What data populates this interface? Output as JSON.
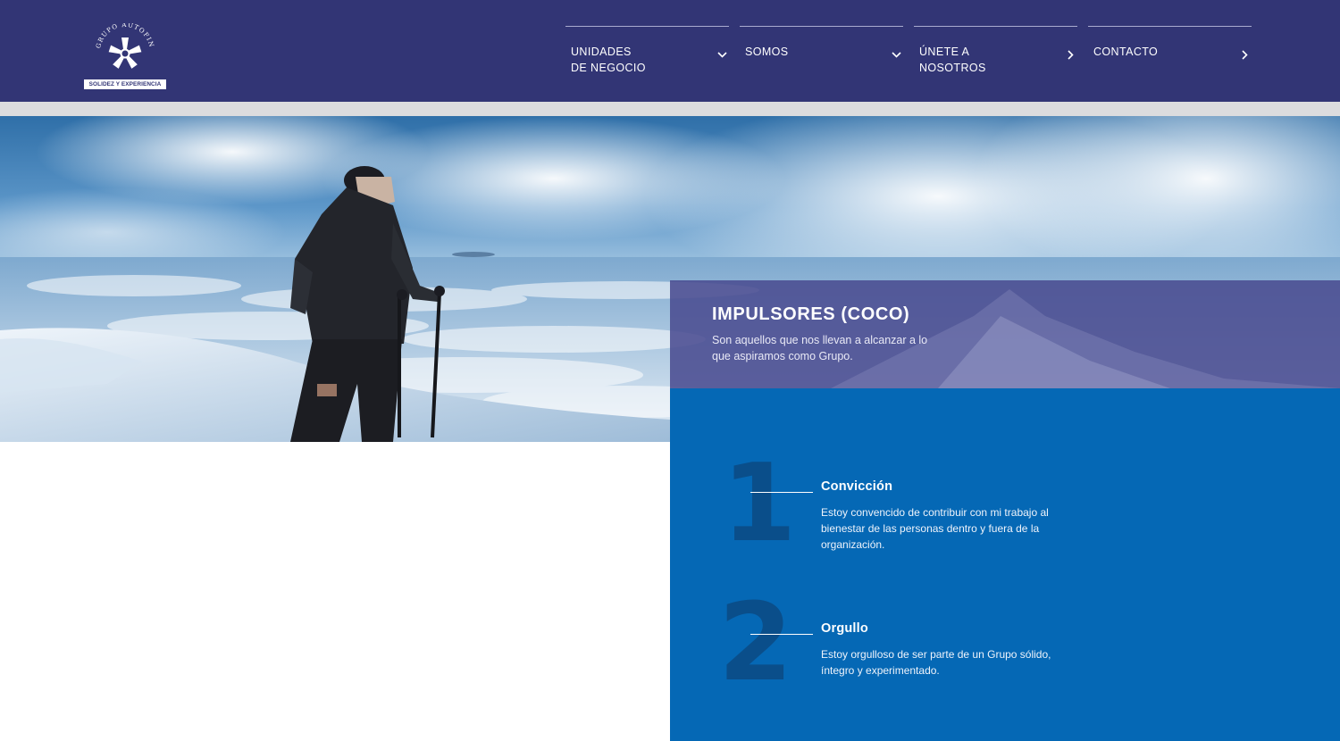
{
  "logo": {
    "arc_text": "GRUPO AUTOFIN MÉXICO",
    "tagline": "SOLIDEZ Y EXPERIENCIA"
  },
  "nav": [
    {
      "label": "UNIDADES\nDE NEGOCIO",
      "icon": "chevron-down-icon"
    },
    {
      "label": "SOMOS",
      "icon": "chevron-down-icon"
    },
    {
      "label": "ÚNETE A\nNOSOTROS",
      "icon": "chevron-right-icon"
    },
    {
      "label": "CONTACTO",
      "icon": "chevron-right-icon"
    }
  ],
  "hero": {
    "image": "mountaineer-with-trekking-poles-above-clouds"
  },
  "section": {
    "title": "IMPULSORES (COCO)",
    "subtitle": "Son aquellos que nos llevan a alcanzar a lo que aspiramos como Grupo."
  },
  "values": [
    {
      "number": "1",
      "title": "Convicción",
      "text": "Estoy convencido de contribuir con mi trabajo al bienestar de las personas dentro y fuera de la organización."
    },
    {
      "number": "2",
      "title": "Orgullo",
      "text": "Estoy orgulloso de ser parte de un Grupo sólido, íntegro y experimentado."
    }
  ],
  "colors": {
    "header": "#323575",
    "panel": "#0568b5",
    "overlay": "#4a4c91",
    "number": "#0a4e8a"
  }
}
